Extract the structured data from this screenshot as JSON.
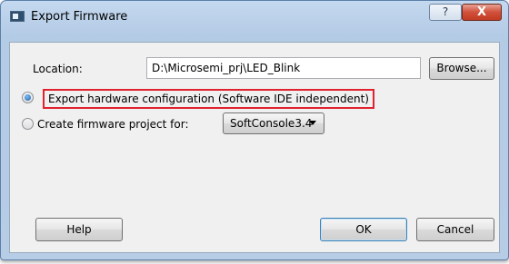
{
  "window": {
    "title": "Export Firmware",
    "help_button_label": "?",
    "close_button_label": "X"
  },
  "location": {
    "label": "Location:",
    "value": "D:\\Microsemi_prj\\LED_Blink",
    "browse_label": "Browse..."
  },
  "options": {
    "export_hw": {
      "label": "Export hardware configuration (Software IDE independent)",
      "selected": true
    },
    "create_fw": {
      "label": "Create firmware project for:",
      "selected": false
    }
  },
  "ide_select": {
    "selected": "SoftConsole3.4"
  },
  "footer": {
    "help_label": "Help",
    "ok_label": "OK",
    "cancel_label": "Cancel"
  },
  "colors": {
    "highlight_box": "#e0222f",
    "close_button": "#c8432c",
    "title_bar": "#b9d0ea"
  }
}
